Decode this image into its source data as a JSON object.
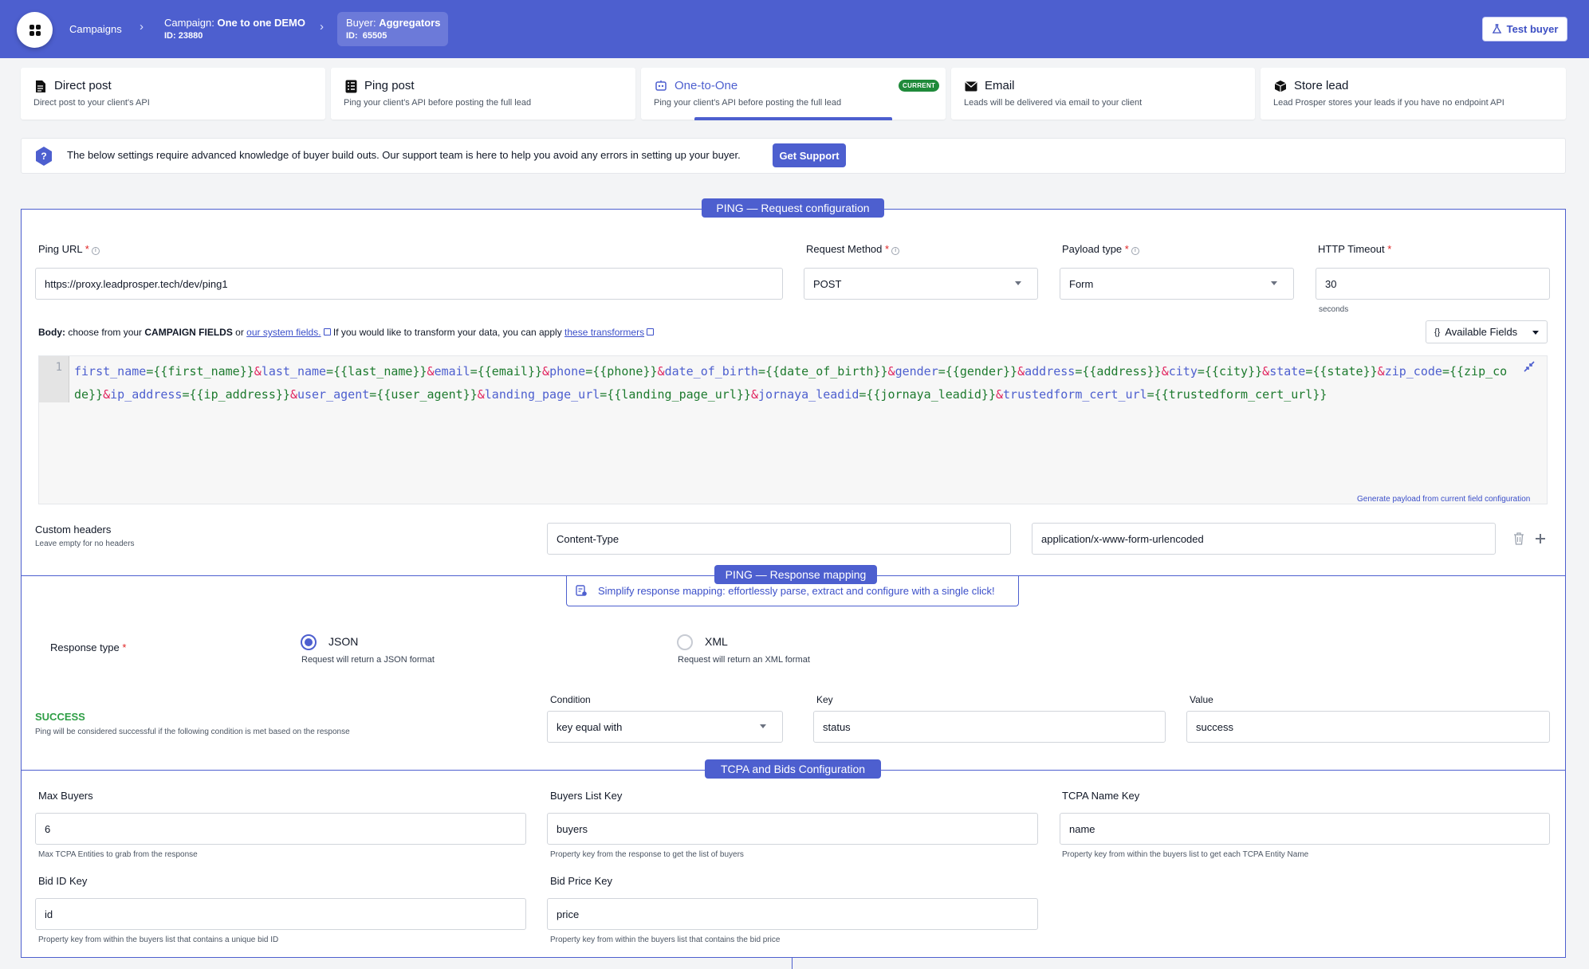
{
  "header": {
    "breadcrumbs": [
      {
        "label": "Campaigns"
      },
      {
        "prefix": "Campaign: ",
        "name": "One to one DEMO",
        "id": "ID: 23880"
      },
      {
        "prefix": "Buyer: ",
        "name": "Aggregators",
        "id": "ID:  65505"
      }
    ],
    "test_buyer_label": "Test buyer"
  },
  "delivery_tabs": [
    {
      "title": "Direct post",
      "desc": "Direct post to your client's API",
      "icon": "document-icon"
    },
    {
      "title": "Ping post",
      "desc": "Ping your client's API before posting the full lead",
      "icon": "list-icon"
    },
    {
      "title": "One-to-One",
      "desc": "Ping your client's API before posting the full lead",
      "icon": "robot-icon",
      "badge": "CURRENT"
    },
    {
      "title": "Email",
      "desc": "Leads will be delivered via email to your client",
      "icon": "envelope-icon"
    },
    {
      "title": "Store lead",
      "desc": "Lead Prosper stores your leads if you have no endpoint API",
      "icon": "box-icon"
    }
  ],
  "info_bar": {
    "text": "The below settings require advanced knowledge of buyer build outs. Our support team is here to help you avoid any errors in setting up your buyer.",
    "button": "Get Support"
  },
  "ping_request": {
    "title": "PING — Request configuration",
    "ping_url": {
      "label": "Ping URL",
      "required": "*",
      "value": "https://proxy.leadprosper.tech/dev/ping1"
    },
    "request_method": {
      "label": "Request Method",
      "required": "*",
      "value": "POST"
    },
    "payload_type": {
      "label": "Payload type",
      "required": "*",
      "value": "Form"
    },
    "http_timeout": {
      "label": "HTTP Timeout",
      "required": "*",
      "value": "30",
      "unit": "seconds"
    },
    "body": {
      "label": "Body:",
      "text1": " choose from your ",
      "campaign_fields": "CAMPAIGN FIELDS",
      "text2": " or ",
      "system_link": "our system fields.",
      "text3": " If you would like to transform your data, you can apply ",
      "transformers_link": "these transformers",
      "available_fields": "Available Fields",
      "line_number": "1",
      "pairs": [
        {
          "key": "first_name",
          "val": "{{first_name}}"
        },
        {
          "key": "last_name",
          "val": "{{last_name}}"
        },
        {
          "key": "email",
          "val": "{{email}}"
        },
        {
          "key": "phone",
          "val": "{{phone}}"
        },
        {
          "key": "date_of_birth",
          "val": "{{date_of_birth}}"
        },
        {
          "key": "gender",
          "val": "{{gender}}"
        },
        {
          "key": "address",
          "val": "{{address}}"
        },
        {
          "key": "city",
          "val": "{{city}}"
        },
        {
          "key": "state",
          "val": "{{state}}"
        },
        {
          "key": "zip_code",
          "val": "{{zip_code}}"
        },
        {
          "key": "ip_address",
          "val": "{{ip_address}}"
        },
        {
          "key": "user_agent",
          "val": "{{user_agent}}"
        },
        {
          "key": "landing_page_url",
          "val": "{{landing_page_url}}"
        },
        {
          "key": "jornaya_leadid",
          "val": "{{jornaya_leadid}}"
        },
        {
          "key": "trustedform_cert_url",
          "val": "{{trustedform_cert_url}}"
        }
      ],
      "generate_link": "Generate payload from current field configuration"
    },
    "custom_headers": {
      "label": "Custom headers",
      "help": "Leave empty for no headers",
      "name": "Content-Type",
      "value": "application/x-www-form-urlencoded"
    }
  },
  "ping_response": {
    "title": "PING — Response mapping",
    "simplify": "Simplify response mapping: effortlessly parse, extract and configure with a single click!",
    "response_type": {
      "label": "Response type",
      "required": "*",
      "options": [
        {
          "label": "JSON",
          "desc": "Request will return a JSON format",
          "selected": true
        },
        {
          "label": "XML",
          "desc": "Request will return an XML format",
          "selected": false
        }
      ]
    },
    "success": {
      "label": "SUCCESS",
      "help": "Ping will be considered successful if the following condition is met based on the response",
      "condition_label": "Condition",
      "condition": "key equal with",
      "key_label": "Key",
      "key": "status",
      "value_label": "Value",
      "value": "success"
    }
  },
  "tcpa": {
    "title": "TCPA and Bids Configuration",
    "max_buyers": {
      "label": "Max Buyers",
      "value": "6",
      "help": "Max TCPA Entities to grab from the response"
    },
    "buyers_list_key": {
      "label": "Buyers List Key",
      "value": "buyers",
      "help": "Property key from the response to get the list of buyers"
    },
    "tcpa_name_key": {
      "label": "TCPA Name Key",
      "value": "name",
      "help": "Property key from within the buyers list to get each TCPA Entity Name"
    },
    "bid_id_key": {
      "label": "Bid ID Key",
      "value": "id",
      "help": "Property key from within the buyers list that contains a unique bid ID"
    },
    "bid_price_key": {
      "label": "Bid Price Key",
      "value": "price",
      "help": "Property key from within the buyers list that contains the bid price"
    }
  },
  "colors": {
    "primary": "#4d5fcf",
    "success": "#2e9e45",
    "required": "#e02424"
  }
}
